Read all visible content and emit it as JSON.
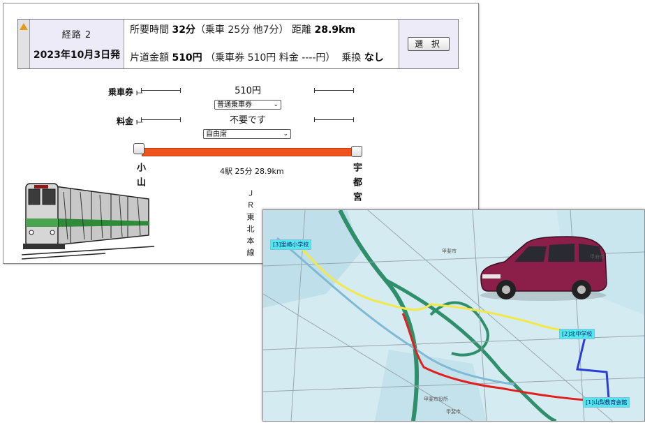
{
  "route": {
    "number_label": "経路 2",
    "date_label": "2023年10月3日発",
    "time_prefix": "所要時間",
    "total_time": "32分",
    "time_breakdown": "（乗車 25分 他7分）",
    "distance_prefix": "距離",
    "distance": "28.9km",
    "fare_prefix": "片道金額",
    "fare": "510円",
    "fare_breakdown": "（乗車券 510円 料金 ----円）",
    "transfer_prefix": "乗換",
    "transfer": "なし",
    "select_button": "選 択"
  },
  "fare_rows": {
    "ticket_label": "乗車券",
    "ticket_value": "510円",
    "ticket_select": "普通乗車券",
    "charge_label": "料金",
    "charge_value": "不要です",
    "charge_select": "自由席"
  },
  "segment": {
    "from_station": "小山",
    "to_station": "宇都宮",
    "summary": "4駅 25分 28.9km",
    "line": "ＪＲ東北本線"
  },
  "map": {
    "labels": {
      "school1": "[3]里崎小学校",
      "school2": "[2]北中学校",
      "hall": "[1]山梨教育会館"
    },
    "towns": [
      "甲斐市",
      "甲府市",
      "甲斐市役所",
      "甲斐市"
    ]
  },
  "colors": {
    "track": "#f0541e",
    "header_bg": "#ecebf7",
    "route_yellow": "#f2e84a",
    "route_red": "#e0201e",
    "route_blue": "#2a3dd6",
    "map_label_bg": "#4fe9ee"
  }
}
